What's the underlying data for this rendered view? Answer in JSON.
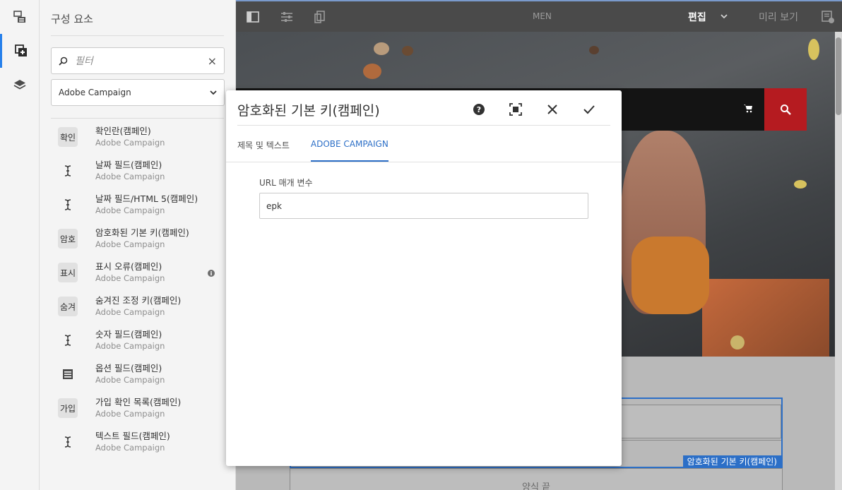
{
  "rail": {
    "items": [
      "page-tree-icon",
      "components-icon",
      "layers-icon"
    ]
  },
  "panel": {
    "title": "구성 요소",
    "filter_placeholder": "필터",
    "clear_icon": "×",
    "group_select": "Adobe Campaign",
    "components": [
      {
        "icon": "abbr",
        "abbr": "확인",
        "name": "확인란(캠페인)",
        "group": "Adobe Campaign"
      },
      {
        "icon": "text-cursor-icon",
        "abbr": "",
        "name": "날짜 필드(캠페인)",
        "group": "Adobe Campaign"
      },
      {
        "icon": "text-cursor-icon",
        "abbr": "",
        "name": "날짜 필드/HTML 5(캠페인)",
        "group": "Adobe Campaign"
      },
      {
        "icon": "abbr",
        "abbr": "암호",
        "name": "암호화된 기본 키(캠페인)",
        "group": "Adobe Campaign"
      },
      {
        "icon": "abbr",
        "abbr": "표시",
        "name": "표시 오류(캠페인)",
        "group": "Adobe Campaign",
        "info": true
      },
      {
        "icon": "abbr",
        "abbr": "숨겨",
        "name": "숨겨진 조정 키(캠페인)",
        "group": "Adobe Campaign"
      },
      {
        "icon": "text-cursor-icon",
        "abbr": "",
        "name": "숫자 필드(캠페인)",
        "group": "Adobe Campaign"
      },
      {
        "icon": "list-icon",
        "abbr": "",
        "name": "옵션 필드(캠페인)",
        "group": "Adobe Campaign"
      },
      {
        "icon": "abbr",
        "abbr": "가입",
        "name": "가입 확인 목록(캠페인)",
        "group": "Adobe Campaign"
      },
      {
        "icon": "text-cursor-icon",
        "abbr": "",
        "name": "텍스트 필드(캠페인)",
        "group": "Adobe Campaign"
      }
    ]
  },
  "toolbar": {
    "center_title": "MEN",
    "edit_label": "편집",
    "preview_label": "미리 보기"
  },
  "page": {
    "form_component_label": "암호화된 기본 키(캠페인)",
    "footer_label": "양식 끝"
  },
  "dialog": {
    "title": "암호화된 기본 키(캠페인)",
    "tabs": [
      {
        "label": "제목 및 텍스트",
        "active": false
      },
      {
        "label": "ADOBE CAMPAIGN",
        "active": true
      }
    ],
    "field_label": "URL 매개 변수",
    "field_value": "epk"
  },
  "colors": {
    "accent": "#2c6fc7",
    "search": "#b51b20",
    "toolbar": "#4a4a4a"
  }
}
